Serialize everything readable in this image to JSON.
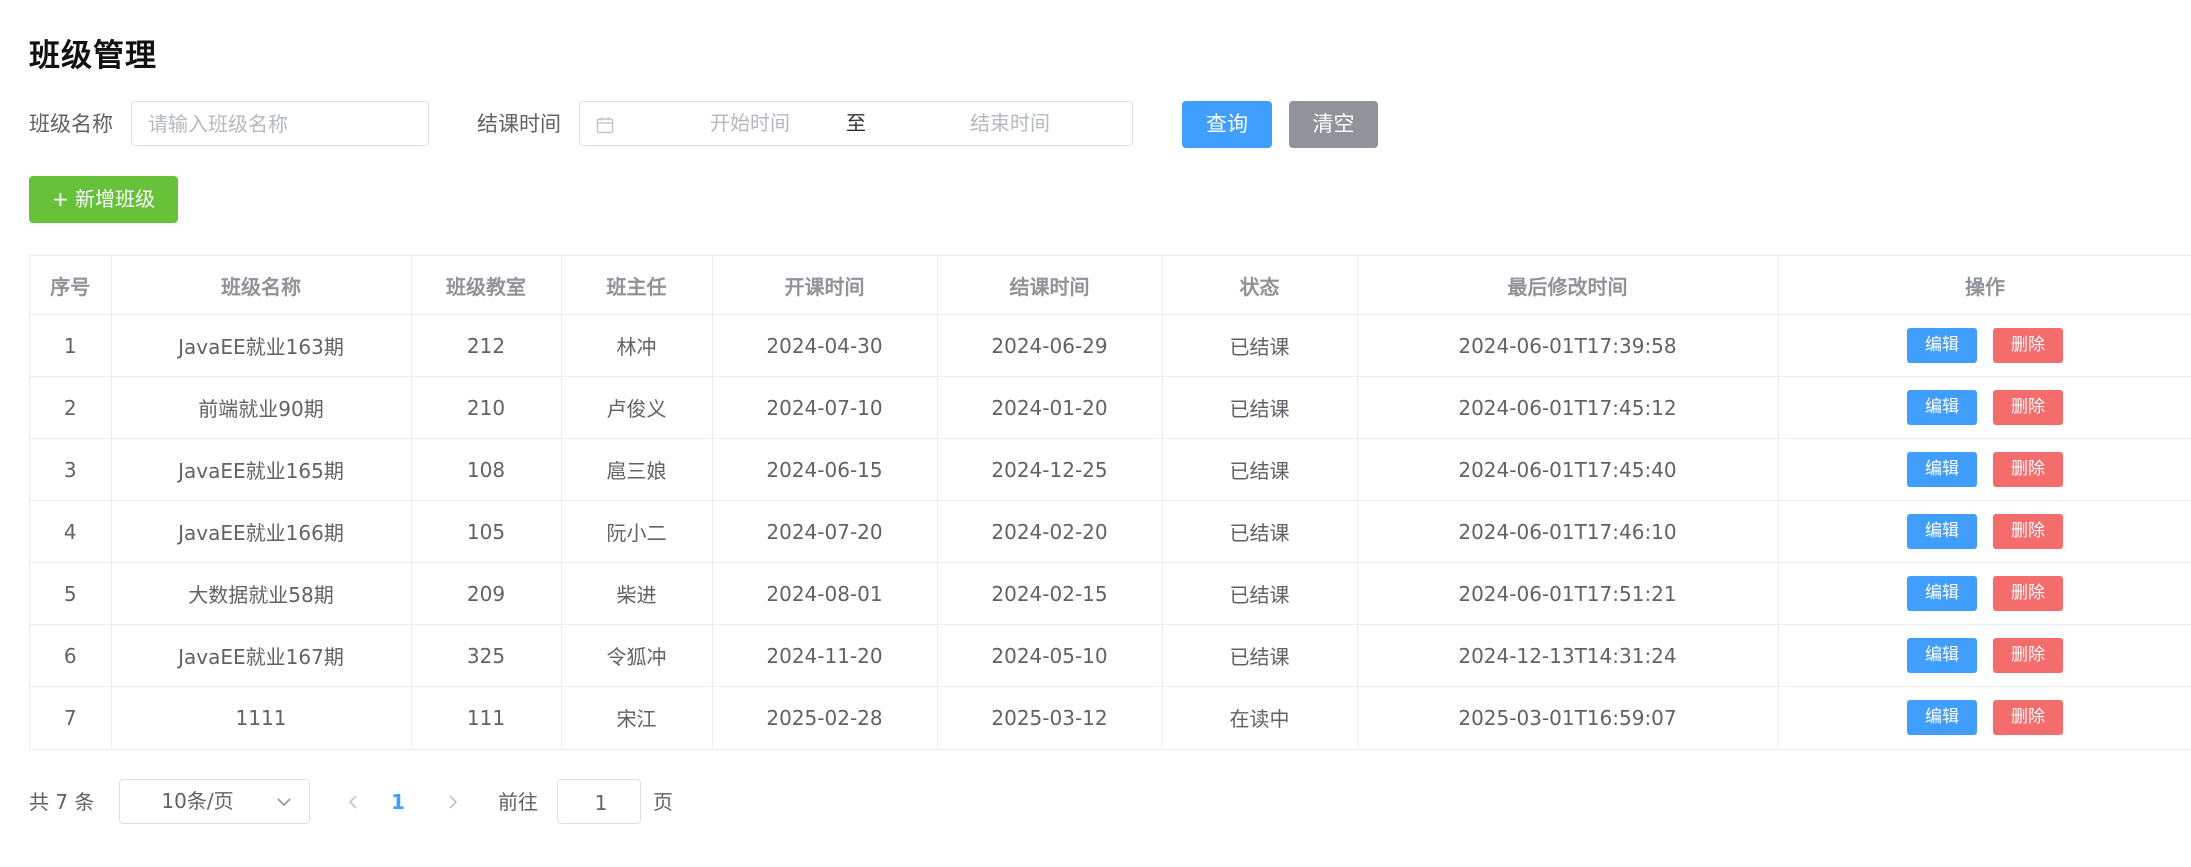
{
  "page": {
    "title": "班级管理"
  },
  "search": {
    "class_name_label": "班级名称",
    "class_name_placeholder": "请输入班级名称",
    "class_name_value": "",
    "end_time_label": "结课时间",
    "start_placeholder": "开始时间",
    "range_separator": "至",
    "end_placeholder": "结束时间",
    "query_button": "查询",
    "clear_button": "清空"
  },
  "toolbar": {
    "add_button": "+ 新增班级"
  },
  "table": {
    "columns": [
      "序号",
      "班级名称",
      "班级教室",
      "班主任",
      "开课时间",
      "结课时间",
      "状态",
      "最后修改时间",
      "操作"
    ],
    "edit_label": "编辑",
    "delete_label": "删除",
    "rows": [
      [
        "1",
        "JavaEE就业163期",
        "212",
        "林冲",
        "2024-04-30",
        "2024-06-29",
        "已结课",
        "2024-06-01T17:39:58"
      ],
      [
        "2",
        "前端就业90期",
        "210",
        "卢俊义",
        "2024-07-10",
        "2024-01-20",
        "已结课",
        "2024-06-01T17:45:12"
      ],
      [
        "3",
        "JavaEE就业165期",
        "108",
        "扈三娘",
        "2024-06-15",
        "2024-12-25",
        "已结课",
        "2024-06-01T17:45:40"
      ],
      [
        "4",
        "JavaEE就业166期",
        "105",
        "阮小二",
        "2024-07-20",
        "2024-02-20",
        "已结课",
        "2024-06-01T17:46:10"
      ],
      [
        "5",
        "大数据就业58期",
        "209",
        "柴进",
        "2024-08-01",
        "2024-02-15",
        "已结课",
        "2024-06-01T17:51:21"
      ],
      [
        "6",
        "JavaEE就业167期",
        "325",
        "令狐冲",
        "2024-11-20",
        "2024-05-10",
        "已结课",
        "2024-12-13T14:31:24"
      ],
      [
        "7",
        "1111",
        "111",
        "宋江",
        "2025-02-28",
        "2025-03-12",
        "在读中",
        "2025-03-01T16:59:07"
      ]
    ]
  },
  "pagination": {
    "total_text": "共 7 条",
    "page_size": "10条/页",
    "current_page": "1",
    "goto_label": "前往",
    "goto_value": "1",
    "page_suffix": "页"
  },
  "colors": {
    "primary": "#409eff",
    "success": "#67c23a",
    "danger": "#f56c6c",
    "info": "#909399",
    "border": "#ebeef5"
  },
  "icons": {
    "date_range": "calendar-icon",
    "page_size": "chevron-down-icon",
    "prev": "chevron-left-icon",
    "next": "chevron-right-icon"
  }
}
